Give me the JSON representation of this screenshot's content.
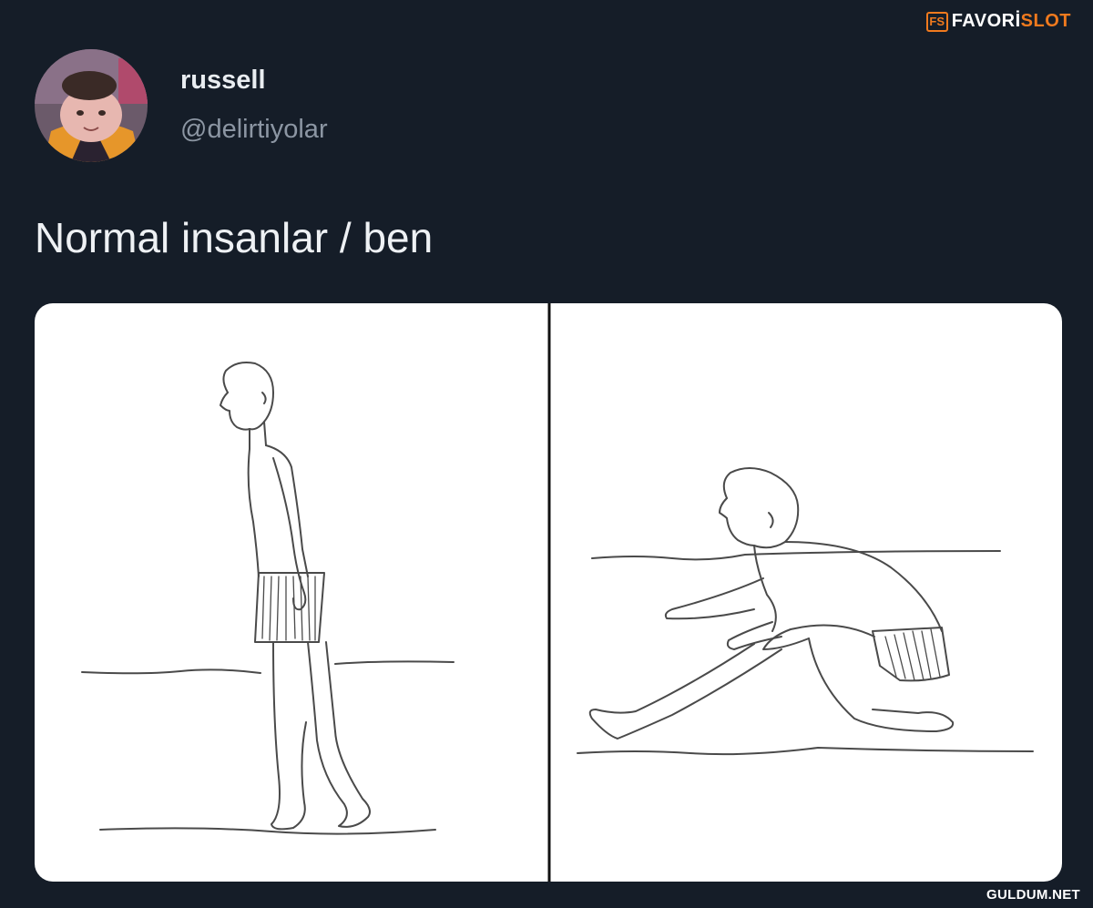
{
  "watermark": {
    "logo_letters": "FS",
    "brand_part1": "FAVORİ",
    "brand_part2": "SLOT",
    "bottom": "GULDUM.NET"
  },
  "tweet": {
    "display_name": "russell",
    "handle": "@delirtiyolar",
    "text": "Normal insanlar / ben"
  },
  "colors": {
    "background": "#151d28",
    "brand_orange": "#f07a1e",
    "name_text": "#e9edf1",
    "handle_text": "#8c96a3"
  }
}
